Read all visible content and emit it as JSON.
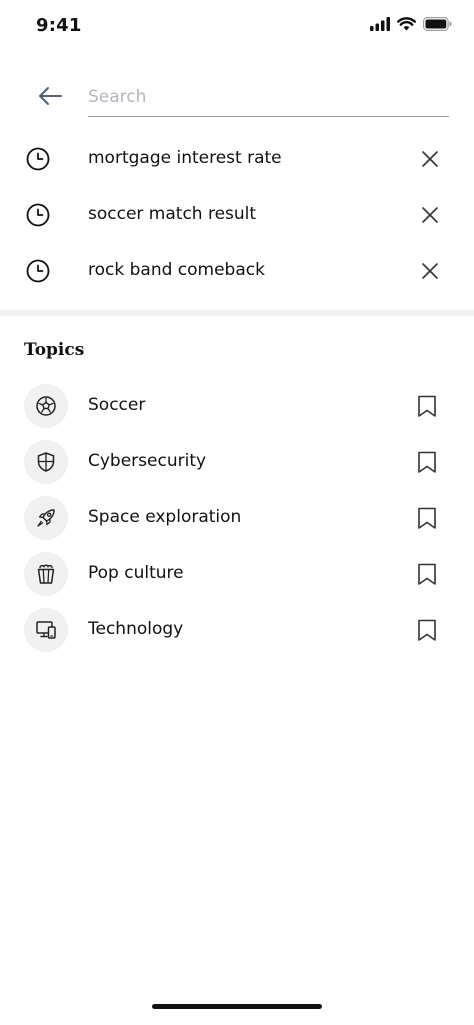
{
  "status_bar": {
    "time": "9:41",
    "icons": [
      "cellular-signal-icon",
      "wifi-icon",
      "battery-icon"
    ]
  },
  "search": {
    "placeholder": "Search",
    "value": "",
    "back_icon": "arrow-left-icon"
  },
  "recent_searches": [
    {
      "label": "mortgage interest rate",
      "icon": "clock-icon",
      "action_icon": "close-icon"
    },
    {
      "label": "soccer match result",
      "icon": "clock-icon",
      "action_icon": "close-icon"
    },
    {
      "label": "rock band comeback",
      "icon": "clock-icon",
      "action_icon": "close-icon"
    }
  ],
  "topics": {
    "title": "Topics",
    "items": [
      {
        "label": "Soccer",
        "icon": "soccer-ball-icon",
        "action_icon": "bookmark-icon"
      },
      {
        "label": "Cybersecurity",
        "icon": "shield-icon",
        "action_icon": "bookmark-icon"
      },
      {
        "label": "Space exploration",
        "icon": "rocket-icon",
        "action_icon": "bookmark-icon"
      },
      {
        "label": "Pop culture",
        "icon": "popcorn-icon",
        "action_icon": "bookmark-icon"
      },
      {
        "label": "Technology",
        "icon": "devices-icon",
        "action_icon": "bookmark-icon"
      }
    ]
  },
  "colors": {
    "text": "#111111",
    "placeholder": "#b5b5bd",
    "divider": "#f2f2f4",
    "icon_badge": "#f1f1f3"
  }
}
